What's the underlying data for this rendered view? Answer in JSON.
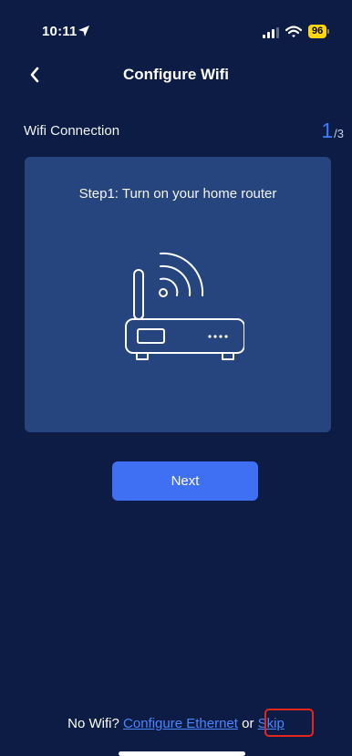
{
  "status_bar": {
    "time": "10:11",
    "battery": "96",
    "icons": [
      "location-arrow-icon",
      "cellular-signal-icon",
      "wifi-icon",
      "battery-icon"
    ]
  },
  "nav": {
    "title": "Configure Wifi",
    "back_icon": "chevron-left-icon"
  },
  "section": {
    "label": "Wifi Connection",
    "step_current": "1",
    "step_total": "/3"
  },
  "card": {
    "instruction": "Step1: Turn on your home router",
    "illustration_icon": "wifi-router-icon"
  },
  "actions": {
    "next_label": "Next"
  },
  "footer": {
    "prefix": "No Wifi? ",
    "ethernet_link": "Configure Ethernet",
    "or_text": " or ",
    "skip_link": "Skip"
  },
  "colors": {
    "background": "#0c1c45",
    "card": "#26457e",
    "accent": "#3f6ff2",
    "link": "#4a86ff",
    "highlight": "#e4261c",
    "battery": "#ffd60a"
  }
}
